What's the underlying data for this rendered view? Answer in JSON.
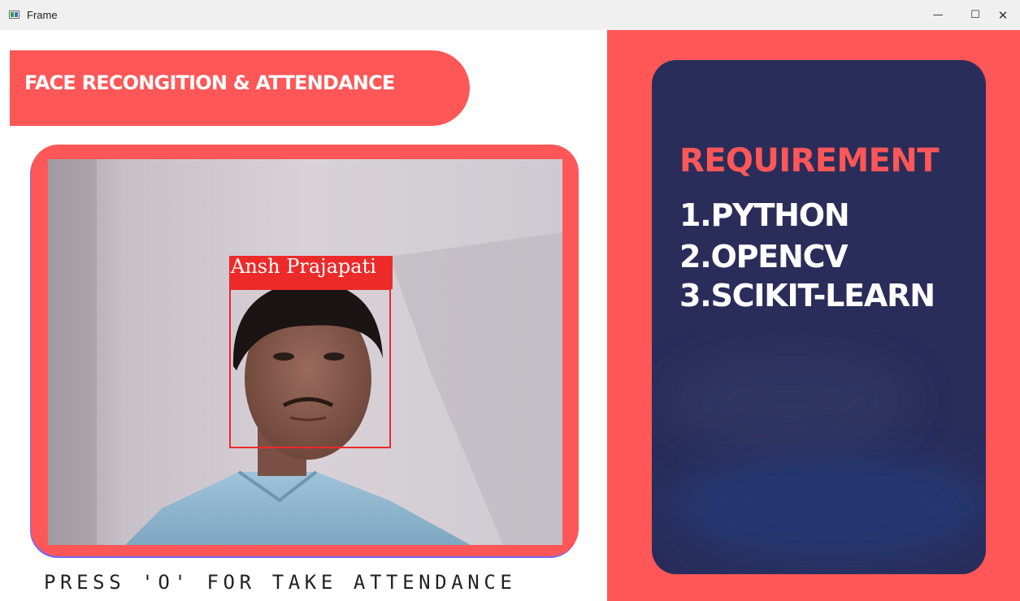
{
  "window": {
    "title": "Frame",
    "minimize_glyph": "—",
    "maximize_glyph": "☐",
    "close_glyph": "✕",
    "app_icon": "window-icon"
  },
  "header": {
    "title": "FACE RECONGITION & ATTENDANCE"
  },
  "camera": {
    "detected_name": "Ansh Prajapati"
  },
  "footer": {
    "instruction": "PRESS 'O' FOR TAKE ATTENDANCE"
  },
  "requirements": {
    "title": "REQUIREMENT",
    "items": [
      "1.PYTHON",
      "2.OPENCV",
      "3.SCIKIT-LEARN"
    ]
  },
  "colors": {
    "accent": "#ff5757",
    "panel": "#2a2d5a",
    "face_box": "#ec2a2a"
  }
}
